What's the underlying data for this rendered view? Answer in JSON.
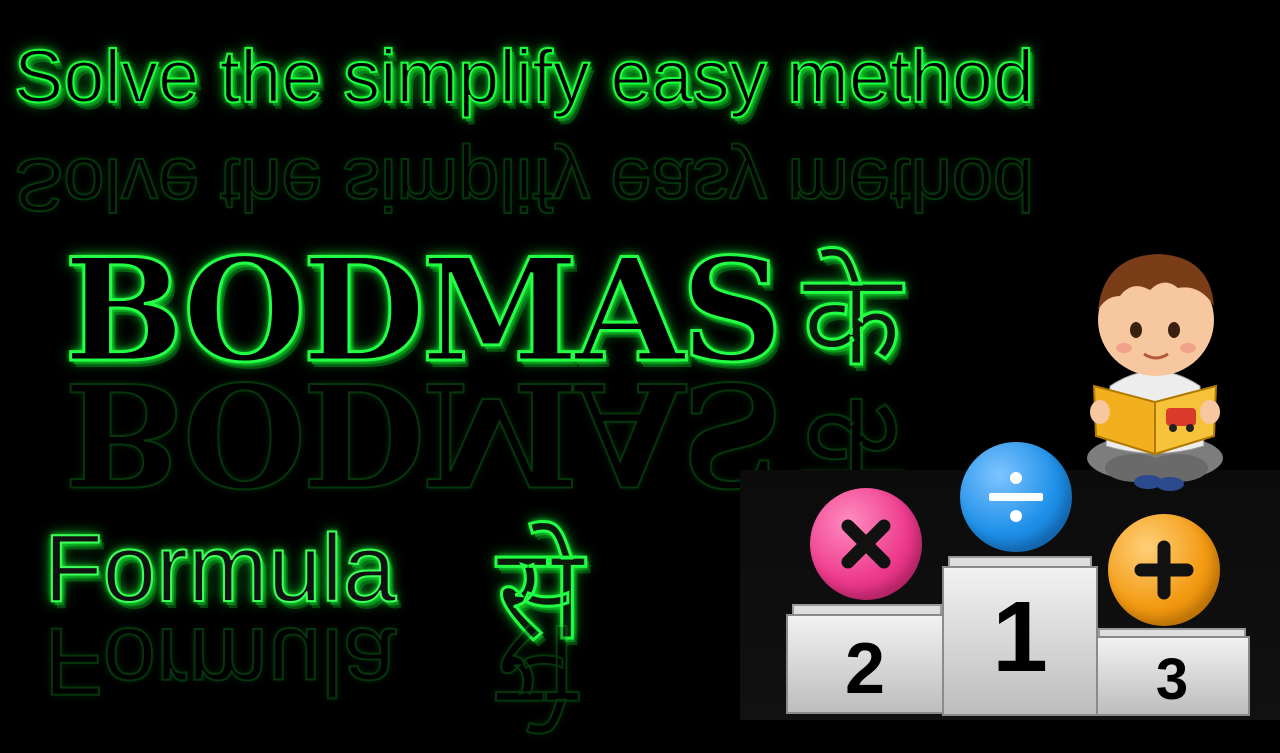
{
  "title": "Solve the simplify easy method",
  "main_word": "BODMAS",
  "hindi_ke": "के",
  "formula_word": "Formula",
  "hindi_se": "से",
  "podium": {
    "first": "1",
    "second": "2",
    "third": "3"
  },
  "symbols": {
    "multiply": "multiply-icon",
    "divide": "divide-icon",
    "plus": "plus-icon"
  },
  "colors": {
    "glow_green": "#19ff3a",
    "multiply_ball": "#ee3a8c",
    "divide_ball": "#1e90e8",
    "plus_ball": "#f39a12"
  }
}
